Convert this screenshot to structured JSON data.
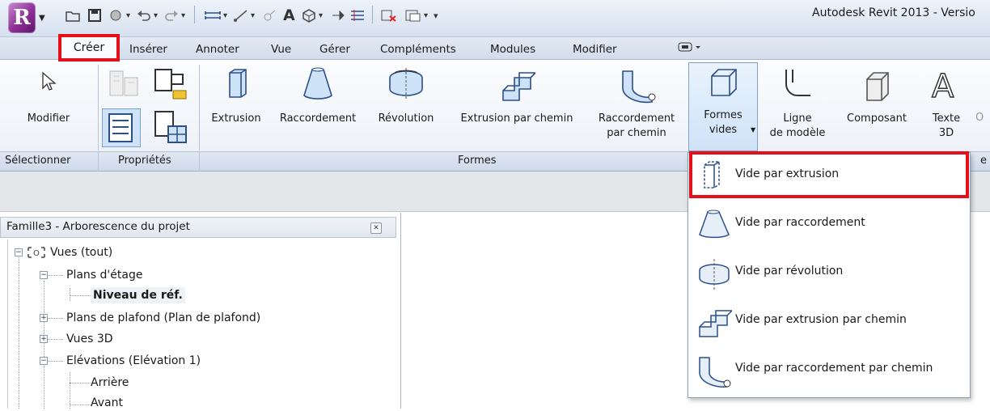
{
  "app": {
    "logo_letter": "R",
    "title": "Autodesk Revit 2013 - Versio"
  },
  "tabs": [
    {
      "label": "Créer"
    },
    {
      "label": "Insérer"
    },
    {
      "label": "Annoter"
    },
    {
      "label": "Vue"
    },
    {
      "label": "Gérer"
    },
    {
      "label": "Compléments"
    },
    {
      "label": "Modules"
    },
    {
      "label": "Modifier"
    }
  ],
  "ribbon": {
    "modifier": "Modifier",
    "extrusion": "Extrusion",
    "raccordement": "Raccordement",
    "revolution": "Révolution",
    "extrusion_chemin": "Extrusion par chemin",
    "raccordement_chemin_1": "Raccordement",
    "raccordement_chemin_2": "par chemin",
    "formes_vides_1": "Formes",
    "formes_vides_2": "vides",
    "ligne_1": "Ligne",
    "ligne_2": "de modèle",
    "composant": "Composant",
    "texte_1": "Texte",
    "texte_2": "3D",
    "cut_letter": "O"
  },
  "panels": {
    "selectionner": "Sélectionner",
    "proprietes": "Propriétés",
    "formes": "Formes",
    "cut": "e"
  },
  "browser": {
    "title": "Famille3 - Arborescence du projet",
    "items": {
      "vues": "Vues (tout)",
      "plans_etage": "Plans d'étage",
      "niveau": "Niveau de réf.",
      "plans_plafond": "Plans de plafond (Plan de plafond)",
      "vues3d": "Vues 3D",
      "elevations": "Elévations (Elévation 1)",
      "arriere": "Arrière",
      "avant": "Avant"
    }
  },
  "menu": {
    "items": [
      {
        "label": "Vide par extrusion"
      },
      {
        "label": "Vide par raccordement"
      },
      {
        "label": "Vide par révolution"
      },
      {
        "label": "Vide par extrusion par chemin"
      },
      {
        "label": "Vide par raccordement par chemin"
      }
    ]
  },
  "colors": {
    "highlight": "#e3101a",
    "ribbon_selected": "#cfe3f8",
    "app_logo": "#8b2f96"
  }
}
